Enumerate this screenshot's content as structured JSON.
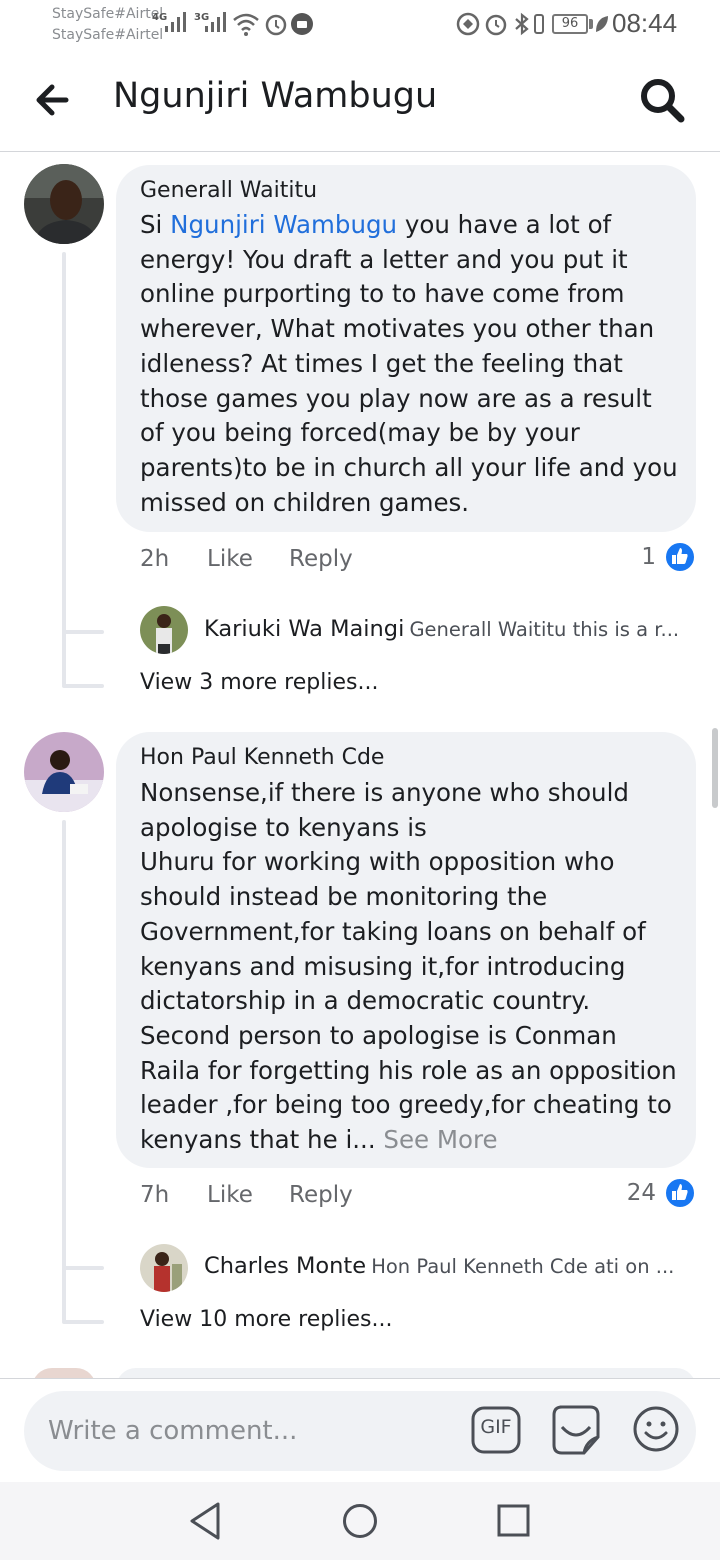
{
  "status_bar": {
    "carrier_1": "StaySafe#Airtel",
    "carrier_2": "StaySafe#Airtel",
    "network_1": "4G",
    "network_2": "3G",
    "battery": "96",
    "time": "08:44"
  },
  "header": {
    "title": "Ngunjiri Wambugu",
    "back_icon": "arrow-left-icon",
    "search_icon": "search-icon"
  },
  "comments": [
    {
      "author": "Generall Waititu",
      "mention": "Ngunjiri Wambugu",
      "text_before": "Si ",
      "text_after": " you have a lot of energy! You draft a letter and you put it online purporting to to have come from wherever, What motivates you other than idleness? At times I get the feeling that those games you play now are as a result of you being forced(may be by your parents)to be in church all your life and you missed on children games.",
      "time": "2h",
      "like_label": "Like",
      "reply_label": "Reply",
      "reaction_count": "1",
      "reply_preview": {
        "author": "Kariuki Wa Maingi",
        "snippet": "Generall Waititu this is a r..."
      },
      "view_more": "View 3 more replies..."
    },
    {
      "author": "Hon Paul Kenneth Cde",
      "text_line_1": "Nonsense,if there is anyone who should apologise to kenyans is",
      "text_line_2": "Uhuru for working with opposition who should instead be monitoring the Government,for taking loans on behalf of kenyans and misusing it,for introducing dictatorship in a democratic country.",
      "text_line_3": "Second person to apologise is Conman Raila for forgetting his role as an opposition leader ,for being too greedy,for cheating to kenyans that he i...",
      "see_more": " See More",
      "time": "7h",
      "like_label": "Like",
      "reply_label": "Reply",
      "reaction_count": "24",
      "reply_preview": {
        "author": "Charles Monte",
        "snippet": "Hon Paul Kenneth Cde ati on ..."
      },
      "view_more": "View 10 more replies..."
    }
  ],
  "composer": {
    "placeholder": "Write a comment...",
    "gif_label": "GIF",
    "sticker_icon": "sticker-icon",
    "emoji_icon": "emoji-icon"
  },
  "nav": {
    "back_icon": "nav-back-icon",
    "home_icon": "nav-home-icon",
    "recents_icon": "nav-recents-icon"
  },
  "colors": {
    "mention": "#216fdb",
    "like_badge": "#1877f2",
    "bubble": "#f0f2f5"
  }
}
